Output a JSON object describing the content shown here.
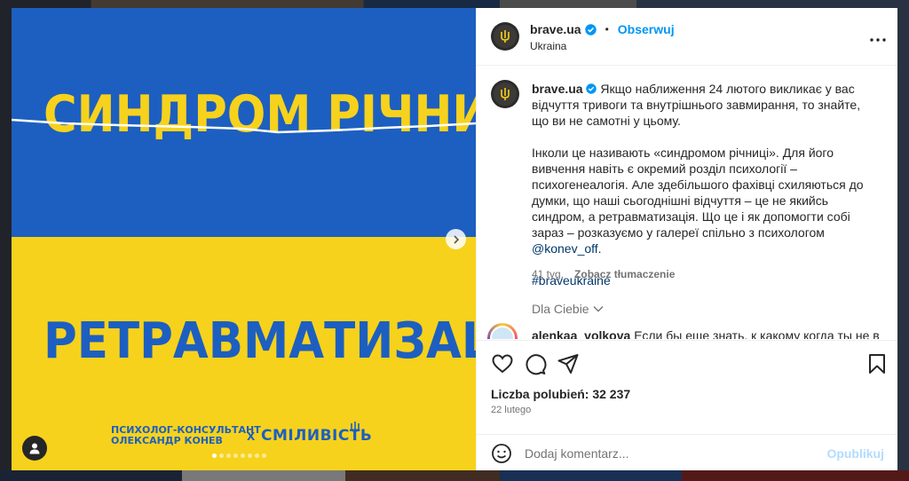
{
  "colors": {
    "flag_blue": "#1d5fc0",
    "flag_yellow": "#f7d21c",
    "accent": "#0095f6",
    "verified": "#0095f6"
  },
  "image": {
    "headline_top": "СИНДРОМ РІЧНИЦІ",
    "headline_bottom": "РЕТРАВМАТИЗАЦІЯ",
    "credit_line1": "ПСИХОЛОГ-КОНСУЛЬТАНТ",
    "credit_line2": "ОЛЕКСАНДР КОНЕВ",
    "credit_x": "Х",
    "brand": "СМІЛИВІСТЬ",
    "carousel_count": 8,
    "carousel_active": 1
  },
  "header": {
    "username": "brave.ua",
    "bullet": "•",
    "follow_label": "Obserwuj",
    "location": "Ukraina",
    "more_icon": "more-horizontal-icon"
  },
  "caption": {
    "username": "brave.ua",
    "p1": "Якщо наближення 24 лютого викликає у вас відчуття тривоги та внутрішнього завмирання, то знайте, що ви не самотні у цьому.",
    "p2_text": "Інколи це називають «синдромом річниці». Для його вивчення навіть є окремий розділ психології – психогенеалогія. Але здебільшого фахівці схиляються до думки, що наші сьогоднішні відчуття – це не якийсь синдром, а ретравматизація. Що це і як допомогти собі зараз – розказуємо у галереї спільно з психологом ",
    "p2_mention": "@konev_off",
    "p2_end": ".",
    "hashtag": "#braveukraine",
    "age": "41 tyg.",
    "translate_label": "Zobacz tłumaczenie"
  },
  "for_you": {
    "label": "Dla Ciebie"
  },
  "next_comment": {
    "username": "alenkaa_volkova",
    "text": "Если бы еще знать, к какому когда ты не в"
  },
  "actions": {
    "likes_label": "Liczba polubień: 32 237",
    "date": "22 lutego"
  },
  "add_comment": {
    "placeholder": "Dodaj komentarz...",
    "publish_label": "Opublikuj"
  }
}
